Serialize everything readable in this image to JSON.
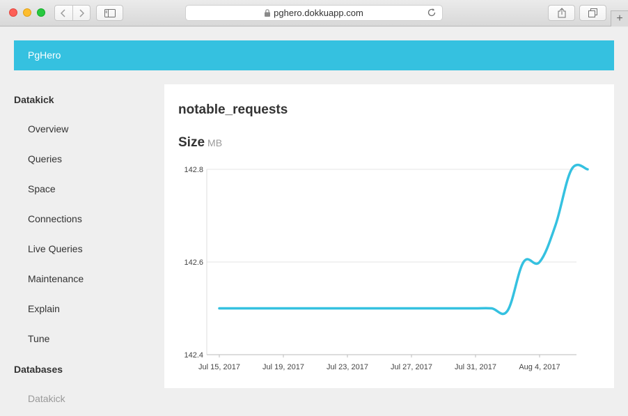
{
  "browser": {
    "url": "pghero.dokkuapp.com"
  },
  "app": {
    "brand": "PgHero"
  },
  "sidebar": {
    "heading": "Datakick",
    "items": [
      {
        "label": "Overview"
      },
      {
        "label": "Queries"
      },
      {
        "label": "Space"
      },
      {
        "label": "Connections"
      },
      {
        "label": "Live Queries"
      },
      {
        "label": "Maintenance"
      },
      {
        "label": "Explain"
      },
      {
        "label": "Tune"
      }
    ],
    "databases_heading": "Databases",
    "databases": [
      {
        "label": "Datakick"
      }
    ]
  },
  "main": {
    "table_name": "notable_requests",
    "size_title": "Size",
    "size_unit": "MB"
  },
  "chart_data": {
    "type": "line",
    "x": [
      "2017-07-15",
      "2017-07-16",
      "2017-07-17",
      "2017-07-18",
      "2017-07-19",
      "2017-07-20",
      "2017-07-21",
      "2017-07-22",
      "2017-07-23",
      "2017-07-24",
      "2017-07-25",
      "2017-07-26",
      "2017-07-27",
      "2017-07-28",
      "2017-07-29",
      "2017-07-30",
      "2017-07-31",
      "2017-08-01",
      "2017-08-02",
      "2017-08-03",
      "2017-08-04",
      "2017-08-05",
      "2017-08-06",
      "2017-08-07"
    ],
    "series": [
      {
        "values": [
          142.5,
          142.5,
          142.5,
          142.5,
          142.5,
          142.5,
          142.5,
          142.5,
          142.5,
          142.5,
          142.5,
          142.5,
          142.5,
          142.5,
          142.5,
          142.5,
          142.5,
          142.5,
          142.495,
          142.6,
          142.6,
          142.68,
          142.8,
          142.8
        ]
      }
    ],
    "ylim": [
      142.4,
      142.8
    ],
    "yticks": [
      "142.4",
      "142.6",
      "142.8"
    ],
    "xticks": [
      {
        "date": "2017-07-15",
        "label": "Jul 15, 2017"
      },
      {
        "date": "2017-07-19",
        "label": "Jul 19, 2017"
      },
      {
        "date": "2017-07-23",
        "label": "Jul 23, 2017"
      },
      {
        "date": "2017-07-27",
        "label": "Jul 27, 2017"
      },
      {
        "date": "2017-07-31",
        "label": "Jul 31, 2017"
      },
      {
        "date": "2017-08-04",
        "label": "Aug 4, 2017"
      }
    ],
    "line_color": "#35c1e0",
    "grid": true
  }
}
